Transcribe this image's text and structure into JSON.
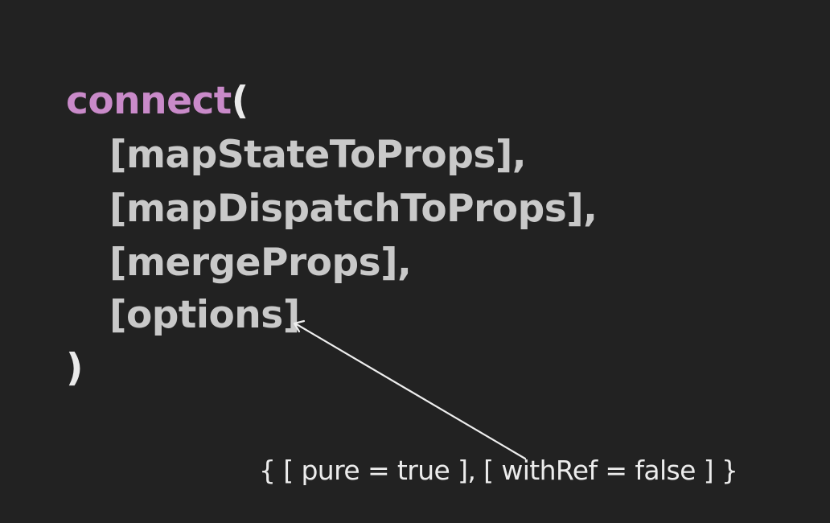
{
  "code": {
    "keyword": "connect",
    "open_paren": "(",
    "params": [
      "[mapStateToProps],",
      "[mapDispatchToProps],",
      "[mergeProps],",
      "[options]"
    ],
    "close_paren": ")"
  },
  "annotation": {
    "text": "{ [ pure = true ], [ withRef = false ] }"
  },
  "colors": {
    "background": "#222222",
    "keyword": "#c98ac9",
    "text": "#d6d6d6"
  },
  "icons": {
    "arrow": "arrow-pointer-icon"
  }
}
